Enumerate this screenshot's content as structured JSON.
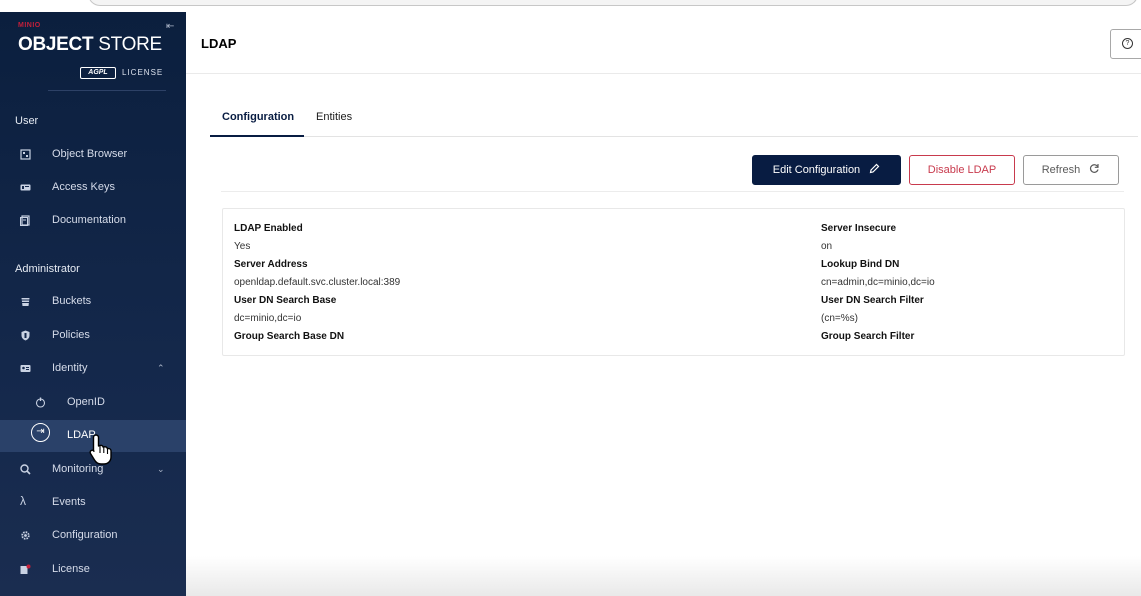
{
  "sidebar": {
    "logo": {
      "brand": "MINIO",
      "product": "OBJECT",
      "product_suffix": " STORE",
      "agpl": "AGPL",
      "license": "LICENSE"
    },
    "sections": {
      "user": "User",
      "admin": "Administrator"
    },
    "items": {
      "object_browser": "Object Browser",
      "access_keys": "Access Keys",
      "documentation": "Documentation",
      "buckets": "Buckets",
      "policies": "Policies",
      "identity": "Identity",
      "openid": "OpenID",
      "ldap": "LDAP",
      "monitoring": "Monitoring",
      "events": "Events",
      "configuration": "Configuration",
      "license": "License"
    }
  },
  "header": {
    "title": "LDAP"
  },
  "tabs": {
    "configuration": "Configuration",
    "entities": "Entities"
  },
  "actions": {
    "edit": "Edit Configuration",
    "disable": "Disable LDAP",
    "refresh": "Refresh"
  },
  "fields": {
    "ldap_enabled": {
      "label": "LDAP Enabled",
      "value": "Yes"
    },
    "server_insecure": {
      "label": "Server Insecure",
      "value": "on"
    },
    "server_address": {
      "label": "Server Address",
      "value": "openldap.default.svc.cluster.local:389"
    },
    "lookup_bind_dn": {
      "label": "Lookup Bind DN",
      "value": "cn=admin,dc=minio,dc=io"
    },
    "user_dn_search_base": {
      "label": "User DN Search Base",
      "value": "dc=minio,dc=io"
    },
    "user_dn_search_filter": {
      "label": "User DN Search Filter",
      "value": "(cn=%s)"
    },
    "group_search_base_dn": {
      "label": "Group Search Base DN",
      "value": ""
    },
    "group_search_filter": {
      "label": "Group Search Filter",
      "value": ""
    }
  },
  "colors": {
    "sidebar_bg": "#0b1f3e",
    "accent": "#081c42",
    "danger": "#c83a4d",
    "brand_red": "#c51f3a"
  }
}
